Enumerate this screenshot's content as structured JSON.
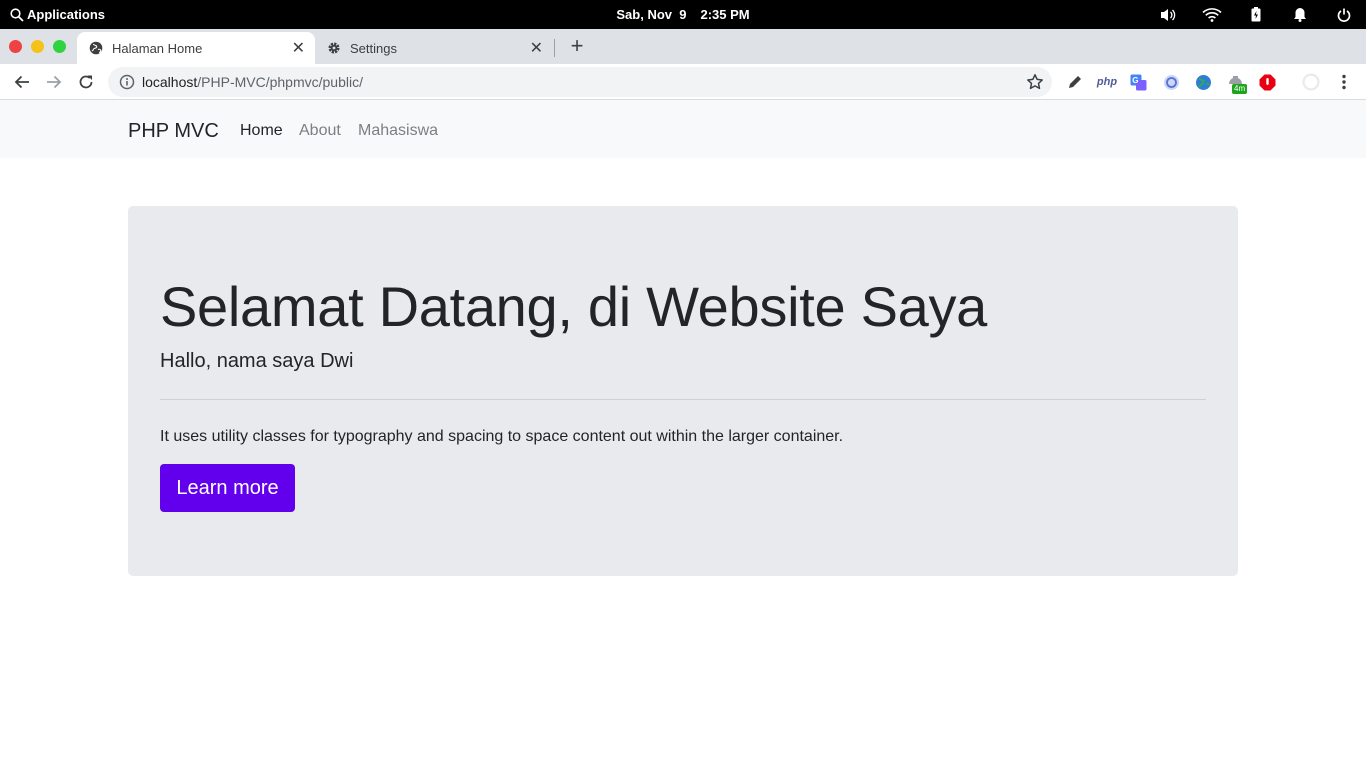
{
  "system_bar": {
    "applications_label": "Applications",
    "date": "Sab, Nov  9",
    "time": "2:35 PM"
  },
  "browser": {
    "tabs": [
      {
        "title": "Halaman Home",
        "icon": "globe-icon",
        "active": true
      },
      {
        "title": "Settings",
        "icon": "gear-icon",
        "active": false
      }
    ],
    "url_host": "localhost",
    "url_path": "/PHP-MVC/phpmvc/public/",
    "extensions": {
      "php_label": "php",
      "badge_text": "4m"
    }
  },
  "navbar": {
    "brand": "PHP MVC",
    "links": [
      {
        "label": "Home",
        "active": true
      },
      {
        "label": "About",
        "active": false
      },
      {
        "label": "Mahasiswa",
        "active": false
      }
    ]
  },
  "jumbotron": {
    "title": "Selamat Datang, di Website Saya",
    "lead": "Hallo, nama saya Dwi",
    "description": "It uses utility classes for typography and spacing to space content out within the larger container.",
    "button_label": "Learn more"
  },
  "colors": {
    "accent": "#6200ee",
    "jumbotron_bg": "#e9eaee",
    "navbar_bg": "#f8f9fa"
  }
}
